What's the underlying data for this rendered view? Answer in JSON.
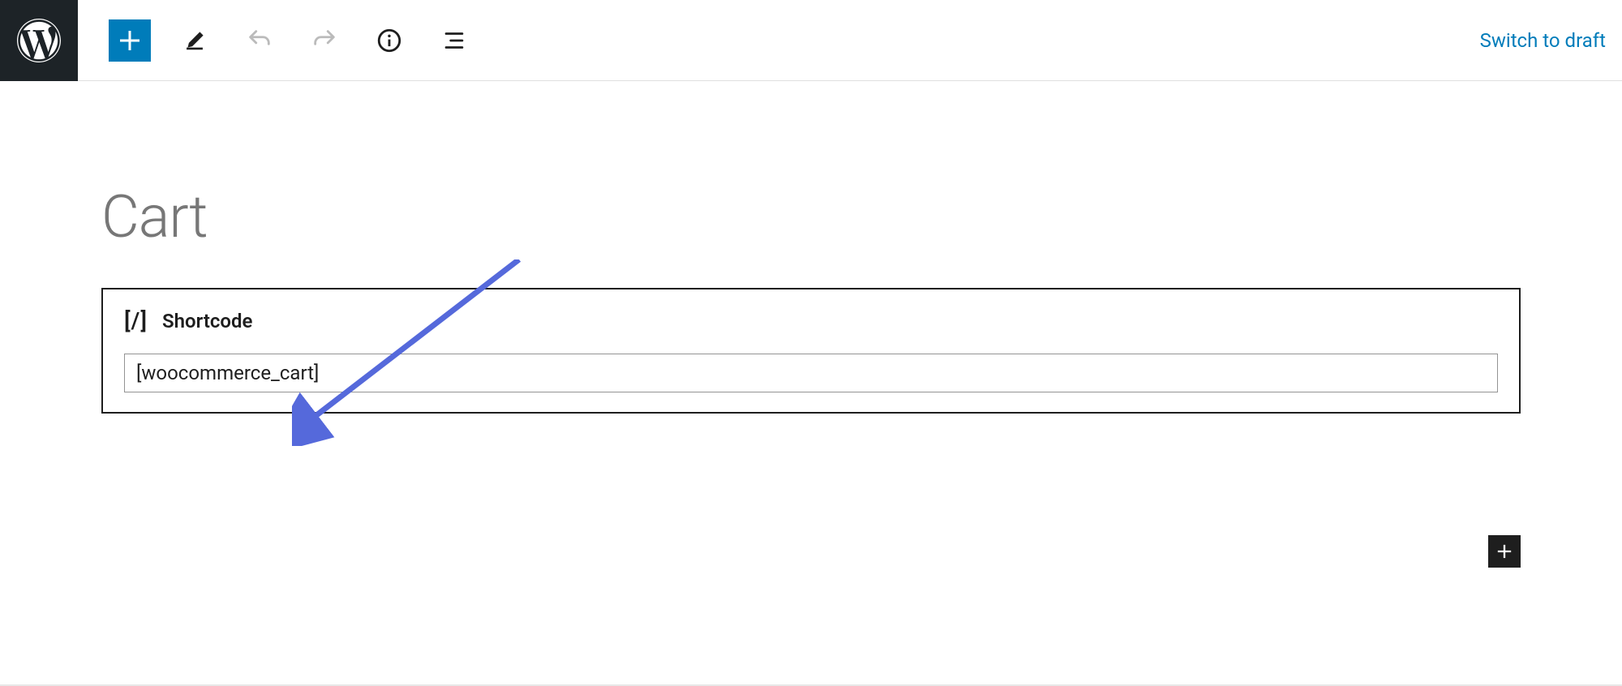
{
  "toolbar": {
    "switch_to_draft_label": "Switch to draft"
  },
  "page": {
    "title": "Cart"
  },
  "block": {
    "label": "Shortcode",
    "icon_text": "[/]",
    "value": "[woocommerce_cart]"
  }
}
